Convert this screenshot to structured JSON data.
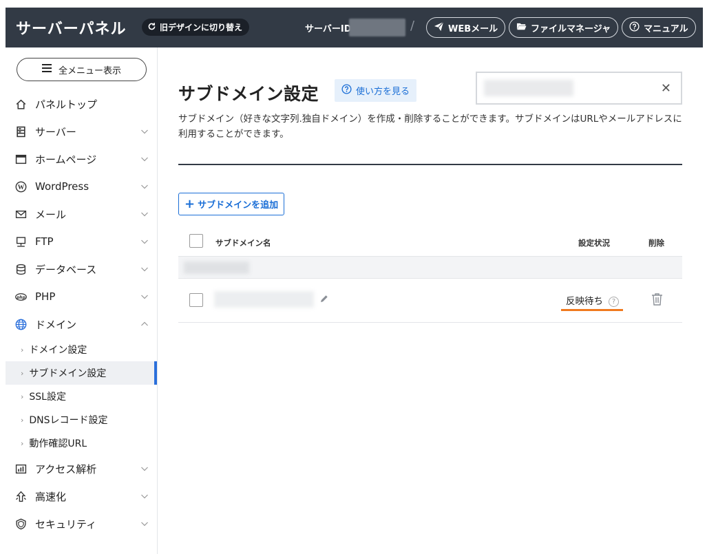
{
  "header": {
    "brand": "サーバーパネル",
    "old_design_label": "旧デザインに切り替え",
    "server_id_label": "サーバーID",
    "separator": "/",
    "webmail_label": "WEBメール",
    "filemanager_label": "ファイルマネージャ",
    "manual_label": "マニュアル",
    "colors": {
      "bar": "#323a45"
    }
  },
  "sidebar": {
    "all_menu_label": "全メニュー表示",
    "items": [
      {
        "label": "パネルトップ",
        "icon": "home-icon"
      },
      {
        "label": "サーバー",
        "icon": "server-icon"
      },
      {
        "label": "ホームページ",
        "icon": "browser-icon"
      },
      {
        "label": "WordPress",
        "icon": "wordpress-icon"
      },
      {
        "label": "メール",
        "icon": "mail-icon"
      },
      {
        "label": "FTP",
        "icon": "ftp-icon"
      },
      {
        "label": "データベース",
        "icon": "database-icon"
      },
      {
        "label": "PHP",
        "icon": "php-icon"
      },
      {
        "label": "ドメイン",
        "icon": "globe-icon"
      },
      {
        "label": "アクセス解析",
        "icon": "chart-icon"
      },
      {
        "label": "高速化",
        "icon": "speed-icon"
      },
      {
        "label": "セキュリティ",
        "icon": "shield-icon"
      }
    ],
    "domain_sub": [
      {
        "label": "ドメイン設定"
      },
      {
        "label": "サブドメイン設定",
        "active": true
      },
      {
        "label": "SSL設定"
      },
      {
        "label": "DNSレコード設定"
      },
      {
        "label": "動作確認URL"
      }
    ]
  },
  "main": {
    "title": "サブドメイン設定",
    "howto_label": "使い方を見る",
    "filter_clear": "✕",
    "description": "サブドメイン（好きな文字列.独自ドメイン）を作成・削除することができます。サブドメインはURLやメールアドレスに利用することができます。",
    "add_label": "サブドメインを追加",
    "table": {
      "col_name": "サブドメイン名",
      "col_status": "設定状況",
      "col_delete": "削除",
      "rows": [
        {
          "status": "反映待ち",
          "status_help": "?"
        }
      ]
    },
    "colors": {
      "accent": "#1a6ed6",
      "status_underline": "#f07a1e"
    }
  }
}
